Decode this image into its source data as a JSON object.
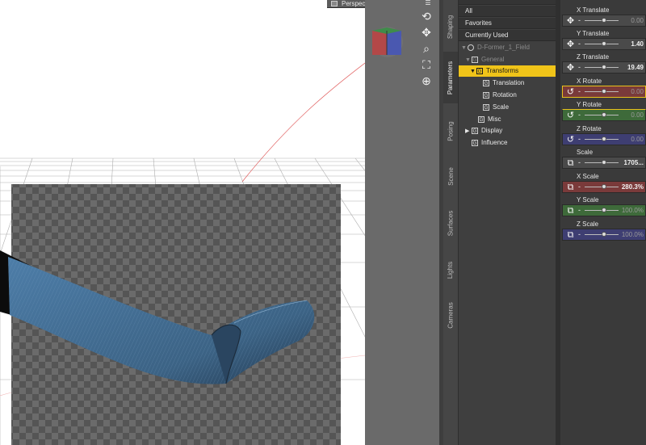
{
  "viewport": {
    "camera_label": "Perspective View",
    "icons": [
      "rotate-icon",
      "pan-icon",
      "zoom-icon",
      "frame-icon",
      "reset-view-icon"
    ]
  },
  "side_tabs": [
    "Shaping",
    "Parameters",
    "Posing",
    "Scene",
    "Surfaces",
    "Lights",
    "Cameras"
  ],
  "active_tab": "Parameters",
  "tree": {
    "filters": [
      "All",
      "Favorites",
      "Currently Used"
    ],
    "items": [
      {
        "label": "D-Former_1_Field",
        "level": 0,
        "arrow": "▼",
        "icon": "node",
        "dim": true
      },
      {
        "label": "General",
        "level": 1,
        "arrow": "▼",
        "icon": "G",
        "dim": true
      },
      {
        "label": "Transforms",
        "level": 2,
        "arrow": "▼",
        "icon": "G",
        "selected": true
      },
      {
        "label": "Translation",
        "level": 3,
        "arrow": "",
        "icon": "G"
      },
      {
        "label": "Rotation",
        "level": 3,
        "arrow": "",
        "icon": "G"
      },
      {
        "label": "Scale",
        "level": 3,
        "arrow": "",
        "icon": "G"
      },
      {
        "label": "Misc",
        "level": 2,
        "arrow": "",
        "icon": "G"
      },
      {
        "label": "Display",
        "level": 1,
        "arrow": "▶",
        "icon": "G"
      },
      {
        "label": "Influence",
        "level": 1,
        "arrow": "",
        "icon": "G"
      }
    ]
  },
  "params": [
    {
      "label": "X Translate",
      "value": "0.00",
      "icon": "translate-icon",
      "color": "#4a4a4a",
      "dim": true
    },
    {
      "label": "Y Translate",
      "value": "1.40",
      "icon": "translate-icon",
      "color": "#4a4a4a",
      "dim": false
    },
    {
      "label": "Z Translate",
      "value": "19.49",
      "icon": "translate-icon",
      "color": "#4a4a4a",
      "dim": false
    },
    {
      "label": "X Rotate",
      "value": "0.00",
      "icon": "rotate-icon",
      "color": "#7a3a3a",
      "dim": true,
      "highlight": true
    },
    {
      "label": "Y Rotate",
      "value": "0.00",
      "icon": "rotate-icon",
      "color": "#3e6a3a",
      "dim": true
    },
    {
      "label": "Z Rotate",
      "value": "0.00",
      "icon": "rotate-icon",
      "color": "#3e3e72",
      "dim": true
    },
    {
      "label": "Scale",
      "value": "1705...",
      "icon": "scale-icon",
      "color": "#4a4a4a",
      "dim": false
    },
    {
      "label": "X Scale",
      "value": "280.3%",
      "icon": "scale-icon",
      "color": "#7a3a3a",
      "dim": false
    },
    {
      "label": "Y Scale",
      "value": "100.0%",
      "icon": "scale-icon",
      "color": "#3e6a3a",
      "dim": true
    },
    {
      "label": "Z Scale",
      "value": "100.0%",
      "icon": "scale-icon",
      "color": "#3e3e72",
      "dim": true
    }
  ],
  "colors": {
    "selection": "#f0c419",
    "x_axis": "#7a3a3a",
    "y_axis": "#3e6a3a",
    "z_axis": "#3e3e72"
  }
}
